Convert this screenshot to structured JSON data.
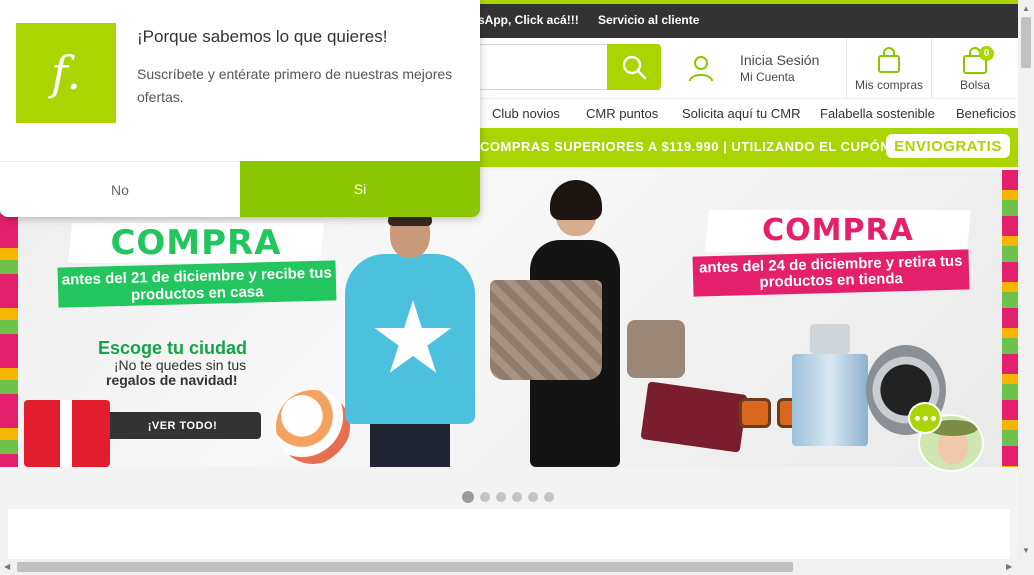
{
  "header": {
    "whatsapp_text": "sApp, Click acá!!!",
    "service_text": "Servicio al cliente",
    "login": {
      "line1": "Inicia Sesión",
      "line2": "Mi Cuenta"
    },
    "purchases_label": "Mis compras",
    "bag_label": "Bolsa",
    "bag_count": "0",
    "search_value": ""
  },
  "nav": {
    "items": [
      {
        "label": "Club novios"
      },
      {
        "label": "CMR puntos"
      },
      {
        "label": "Solicita aquí tu CMR"
      },
      {
        "label": "Falabella sostenible"
      },
      {
        "label": "Beneficios"
      }
    ]
  },
  "promo": {
    "text": "COMPRAS SUPERIORES A $119.990 | UTILIZANDO EL CUPÓN",
    "coupon": "ENVIOGRATIS"
  },
  "banner": {
    "left_title": "COMPRA",
    "left_subtitle": "antes del 21 de diciembre y recibe tus productos en casa",
    "escoge": "Escoge tu ciudad",
    "no_te": "¡No te quedes sin tus",
    "regalos": "regalos de navidad!",
    "cta": "¡VER TODO!",
    "right_title": "COMPRA",
    "right_subtitle": "antes del 24 de diciembre y retira tus productos en tienda"
  },
  "carousel": {
    "slide_count": 6,
    "active_index": 0
  },
  "popup": {
    "logo_letter": "f.",
    "title": "¡Porque sabemos lo que quieres!",
    "description": "Suscríbete y entérate primero de nuestras mejores ofertas.",
    "no_label": "No",
    "si_label": "Si"
  },
  "colors": {
    "brand_green": "#aad500",
    "popup_si_green": "#8cc600",
    "compra_green": "#22c55e",
    "compra_pink": "#e41f6c",
    "topbar_dark": "#333333"
  },
  "icons": [
    "search-icon",
    "user-icon",
    "shopping-bag-icon",
    "cart-bag-icon",
    "chat-icon"
  ]
}
